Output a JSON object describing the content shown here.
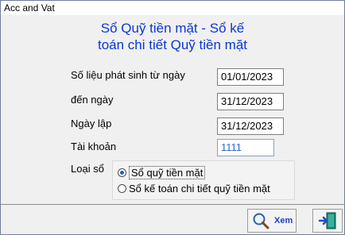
{
  "window": {
    "title": "Acc and Vat"
  },
  "header": {
    "line1": "Sổ Quỹ tiền mặt - Sổ kế",
    "line2": "toán chi tiết Quỹ tiền mặt"
  },
  "form": {
    "from_label": "Số liệu phát sinh từ ngày",
    "from_value": "01/01/2023",
    "to_label": "đến ngày",
    "to_value": "31/12/2023",
    "created_label": "Ngày lập",
    "created_value": "31/12/2023",
    "account_label": "Tài khoản",
    "account_value": "1111",
    "type_label": "Loại sổ",
    "types": [
      {
        "label": "Sổ quỹ tiền mặt",
        "selected": true
      },
      {
        "label": "Sổ kế toán chi tiết quỹ tiền mặt",
        "selected": false
      }
    ]
  },
  "buttons": {
    "view_label": "Xem",
    "view_icon": "magnifier-icon",
    "exit_icon": "exit-door-icon"
  }
}
